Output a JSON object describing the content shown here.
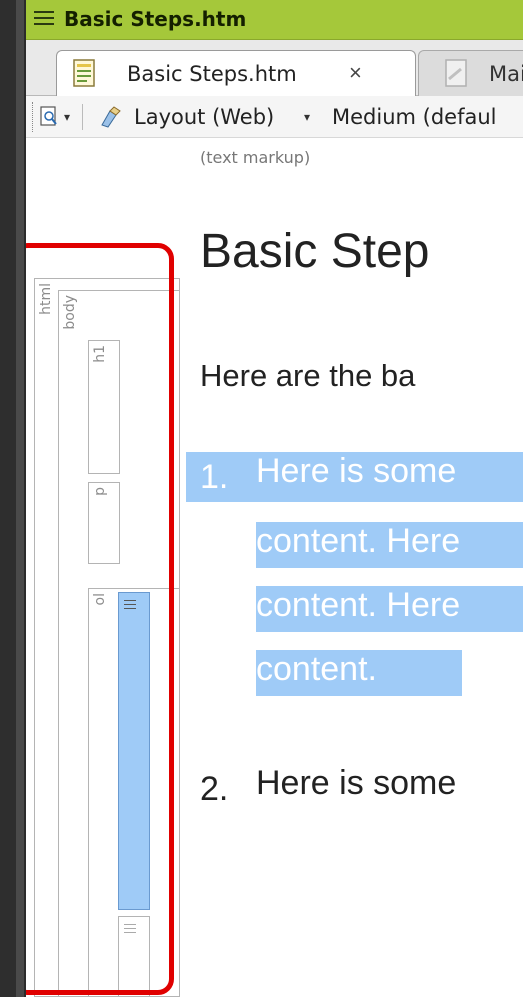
{
  "window": {
    "title": "Basic Steps.htm"
  },
  "tabs": [
    {
      "label": "Basic Steps.htm",
      "close_label": "×",
      "active": true
    },
    {
      "label": "Mair",
      "active": false
    }
  ],
  "toolbar": {
    "layout_label": "Layout (Web)",
    "medium_label": "Medium (defaul",
    "dropdown_arrow": "▾"
  },
  "view": {
    "markup_label": "(text markup)"
  },
  "structure_bar": {
    "tags": [
      "html",
      "body",
      "h1",
      "p",
      "ol"
    ],
    "list_item_glyph": "li-icon"
  },
  "document": {
    "heading": "Basic Step",
    "paragraph": "Here are the ba",
    "list": [
      {
        "number": "1.",
        "lines": [
          "Here is some",
          "content. Here",
          "content. Here",
          "content."
        ],
        "selected": true
      },
      {
        "number": "2.",
        "lines": [
          "Here is some"
        ],
        "selected": false
      }
    ]
  },
  "colors": {
    "title_bar": "#a5c83a",
    "selection": "#9fcbf7",
    "highlight_frame": "#e00000"
  }
}
